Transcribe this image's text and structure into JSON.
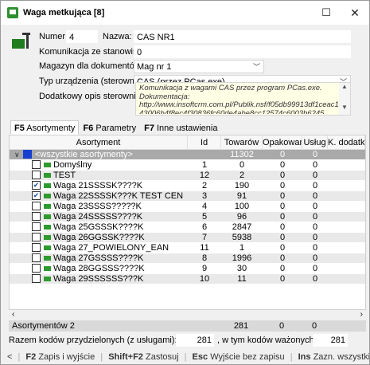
{
  "window": {
    "title": "Waga metkująca [8]",
    "minimize": "☐",
    "close": "✕"
  },
  "form": {
    "numer_label": "Numer:",
    "numer_value": "4",
    "nazwa_label": "Nazwa:",
    "nazwa_value": "CAS NR1",
    "komunikacja_label": "Komunikacja ze stanowiska:",
    "komunikacja_value": "0",
    "magazyn_label": "Magazyn dla dokumentów:",
    "magazyn_value": "Mag nr 1",
    "typ_label": "Typ urządzenia (sterownik):",
    "typ_value": "CAS (przez PCas.exe)",
    "opis_label": "Dodatkowy opis sterownika:",
    "opis_line1": "Komunikacja z wagami CAS przez program PCas.exe.",
    "opis_line2": "Dokumentacja:",
    "opis_line3": "http://www.insoftcrm.com.pl/Publik.nsf/f05db99913df1ceac12571",
    "opis_line4": "43006b4f8ec4f30836fc60de4abe8cc12574c6003b6245",
    "opis_scroll_up": "▲",
    "opis_scroll_down": "▼"
  },
  "tabs": [
    {
      "key": "F5",
      "label": "Asortymenty"
    },
    {
      "key": "F6",
      "label": "Parametry"
    },
    {
      "key": "F7",
      "label": "Inne ustawienia"
    }
  ],
  "grid": {
    "headers": {
      "asortyment": "Asortyment",
      "id": "Id",
      "towarow": "Towarów",
      "opakowan": "Opakowań",
      "uslug": "Usług",
      "kdodatkow": "K. dodatkow"
    },
    "all_row": {
      "name": "<wszystkie asortymenty>",
      "towarow": "11302",
      "opakowan": "0",
      "uslug": "0"
    },
    "rows": [
      {
        "name": "Domyślny",
        "id": "1",
        "towarow": "0",
        "opakowan": "0",
        "uslug": "0",
        "checked": false,
        "gray": false
      },
      {
        "name": "TEST",
        "id": "12",
        "towarow": "2",
        "opakowan": "0",
        "uslug": "0",
        "checked": false,
        "gray": true
      },
      {
        "name": "Waga 21SSSSK????K",
        "id": "2",
        "towarow": "190",
        "opakowan": "0",
        "uslug": "0",
        "checked": true,
        "gray": false
      },
      {
        "name": "Waga 22SSSSK???K TEST CEN",
        "id": "3",
        "towarow": "91",
        "opakowan": "0",
        "uslug": "0",
        "checked": true,
        "gray": true
      },
      {
        "name": "Waga 23SSSS?????K",
        "id": "4",
        "towarow": "100",
        "opakowan": "0",
        "uslug": "0",
        "checked": false,
        "gray": false
      },
      {
        "name": "Waga 24SSSSS????K",
        "id": "5",
        "towarow": "96",
        "opakowan": "0",
        "uslug": "0",
        "checked": false,
        "gray": true
      },
      {
        "name": "Waga 25GSSSK????K",
        "id": "6",
        "towarow": "2847",
        "opakowan": "0",
        "uslug": "0",
        "checked": false,
        "gray": false
      },
      {
        "name": "Waga 26GGSSK????K",
        "id": "7",
        "towarow": "5938",
        "opakowan": "0",
        "uslug": "0",
        "checked": false,
        "gray": true
      },
      {
        "name": "Waga 27_POWIELONY_EAN",
        "id": "11",
        "towarow": "1",
        "opakowan": "0",
        "uslug": "0",
        "checked": false,
        "gray": false
      },
      {
        "name": "Waga 27GSSSS????K",
        "id": "8",
        "towarow": "1996",
        "opakowan": "0",
        "uslug": "0",
        "checked": false,
        "gray": true
      },
      {
        "name": "Waga 28GGSSS????K",
        "id": "9",
        "towarow": "30",
        "opakowan": "0",
        "uslug": "0",
        "checked": false,
        "gray": false
      },
      {
        "name": "Waga 29SSSSSS???K",
        "id": "10",
        "towarow": "11",
        "opakowan": "0",
        "uslug": "0",
        "checked": false,
        "gray": true
      }
    ]
  },
  "summary": {
    "label": "Asortymentów 2",
    "towarow": "281",
    "opakowan": "0",
    "uslug": "0"
  },
  "status": {
    "label1": "Razem kodów przydzielonych (z usługami):",
    "value1": "281",
    "label2": ", w tym kodów ważonych:",
    "value2": "281"
  },
  "footer": {
    "left_arrow": "<",
    "f2_key": "F2",
    "f2_label": "Zapis i wyjście",
    "sf2_key": "Shift+F2",
    "sf2_label": "Zastosuj",
    "esc_key": "Esc",
    "esc_label": "Wyjście bez zapisu",
    "ins_key": "Ins",
    "ins_label": "Zazn. wszystkie",
    "cut_key": "[",
    "right_arrow": ">"
  }
}
